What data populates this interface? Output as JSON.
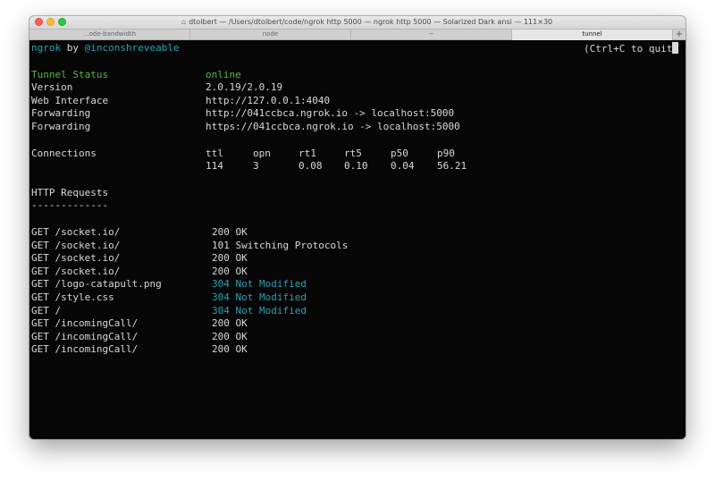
{
  "window": {
    "title": "dtolbert — /Users/dtolbert/code/ngrok http 5000 — ngrok http 5000 — Solarized Dark ansi — 111×30",
    "tabs": [
      {
        "label": "...ode-bandwidth"
      },
      {
        "label": "node"
      },
      {
        "label": "~"
      },
      {
        "label": "tunnel"
      }
    ],
    "add_tab_label": "+"
  },
  "colors": {
    "terminal_bg": "#060606",
    "text": "#d9d9d9",
    "accent_teal": "#2aa1b3",
    "status_green": "#56b93b"
  },
  "header": {
    "app": "ngrok",
    "by": "by",
    "handle": "@inconshreveable",
    "hint": "(Ctrl+C to quit"
  },
  "status": [
    {
      "label": "Tunnel Status",
      "value": "online"
    },
    {
      "label": "Version",
      "value": "2.0.19/2.0.19"
    },
    {
      "label": "Web Interface",
      "value": "http://127.0.0.1:4040"
    },
    {
      "label": "Forwarding",
      "value": "http://041ccbca.ngrok.io -> localhost:5000"
    },
    {
      "label": "Forwarding",
      "value": "https://041ccbca.ngrok.io -> localhost:5000"
    }
  ],
  "connections": {
    "label": "Connections",
    "columns": [
      "ttl",
      "opn",
      "rt1",
      "rt5",
      "p50",
      "p90"
    ],
    "values": [
      "114",
      "3",
      "0.08",
      "0.10",
      "0.04",
      "56.21"
    ]
  },
  "http": {
    "heading": "HTTP Requests",
    "rule": "-------------",
    "requests": [
      {
        "request": "GET /socket.io/",
        "code": "200",
        "text": "OK"
      },
      {
        "request": "GET /socket.io/",
        "code": "101",
        "text": "Switching Protocols"
      },
      {
        "request": "GET /socket.io/",
        "code": "200",
        "text": "OK"
      },
      {
        "request": "GET /socket.io/",
        "code": "200",
        "text": "OK"
      },
      {
        "request": "GET /logo-catapult.png",
        "code": "304",
        "text": "Not Modified"
      },
      {
        "request": "GET /style.css",
        "code": "304",
        "text": "Not Modified"
      },
      {
        "request": "GET /",
        "code": "304",
        "text": "Not Modified"
      },
      {
        "request": "GET /incomingCall/",
        "code": "200",
        "text": "OK"
      },
      {
        "request": "GET /incomingCall/",
        "code": "200",
        "text": "OK"
      },
      {
        "request": "GET /incomingCall/",
        "code": "200",
        "text": "OK"
      }
    ]
  }
}
